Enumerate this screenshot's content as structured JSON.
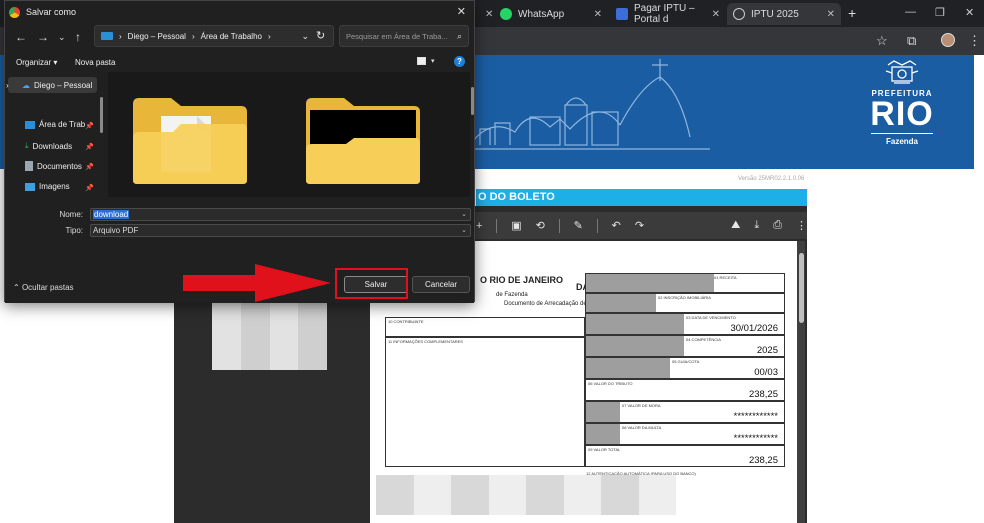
{
  "browser": {
    "tabs": [
      {
        "label": "WhatsApp",
        "icon": "whatsapp-icon"
      },
      {
        "label": "Pagar IPTU – Portal d",
        "icon": "portal-icon"
      },
      {
        "label": "IPTU 2025",
        "icon": "globe-icon"
      }
    ],
    "new_tab": "+"
  },
  "page": {
    "logo": {
      "prefeitura": "PREFEITURA",
      "rio": "RIO",
      "fazenda": "Fazenda"
    },
    "version": "Versão 25MR02.2.1.0.06",
    "section_title": "O DO BOLETO",
    "colors": {
      "banner": "#1b5da2",
      "section_bar": "#1eaee8"
    }
  },
  "darm": {
    "gov_title": "O RIO DE JANEIRO",
    "fazenda": "de Fazenda",
    "doc_title": "Documento de Arrecadação de Receitas Municipais",
    "darm": "DARM",
    "rio": "RIO",
    "fields": [
      {
        "label": "01 RECEITA",
        "value": ""
      },
      {
        "label": "02 INSCRIÇÃO IMOBILIÁRIA",
        "value": ""
      },
      {
        "label": "03 DATA DE VENCIMENTO",
        "value": "30/01/2026"
      },
      {
        "label": "04 COMPETÊNCIA",
        "value": "2025"
      },
      {
        "label": "05 GUIA/COTA",
        "value": "00/03"
      },
      {
        "label": "06 VALOR DO TRIBUTO",
        "value": "238,25"
      },
      {
        "label": "07 VALOR DE MORA",
        "value": "************"
      },
      {
        "label": "08 VALOR DA MULTA",
        "value": "************"
      },
      {
        "label": "09 VALOR TOTAL",
        "value": "238,25"
      }
    ],
    "contribuinte_label": "10 CONTRIBUINTE",
    "info_label": "11 INFORMAÇÕES COMPLEMENTARES",
    "auth_label": "12 AUTENTICAÇÃO AUTOMÁTICA (PARA USO DO BANCO)"
  },
  "dialog": {
    "title": "Salvar como",
    "breadcrumb": [
      "Diego – Pessoal",
      "Área de Trabalho"
    ],
    "search_placeholder": "Pesquisar em Área de Traba...",
    "organize": "Organizar ▾",
    "new_folder": "Nova pasta",
    "nav": [
      {
        "label": "Diego – Pessoal",
        "icon": "cloud-icon"
      },
      {
        "label": "Área de Trab",
        "icon": "desktop-icon"
      },
      {
        "label": "Downloads",
        "icon": "download-icon"
      },
      {
        "label": "Documentos",
        "icon": "document-icon"
      },
      {
        "label": "Imagens",
        "icon": "image-icon"
      }
    ],
    "name_label": "Nome:",
    "name_value": "download",
    "type_label": "Tipo:",
    "type_value": "Arquivo PDF",
    "hide_folders": "Ocultar pastas",
    "save": "Salvar",
    "cancel": "Cancelar",
    "annotation_color": "#e0111a"
  }
}
